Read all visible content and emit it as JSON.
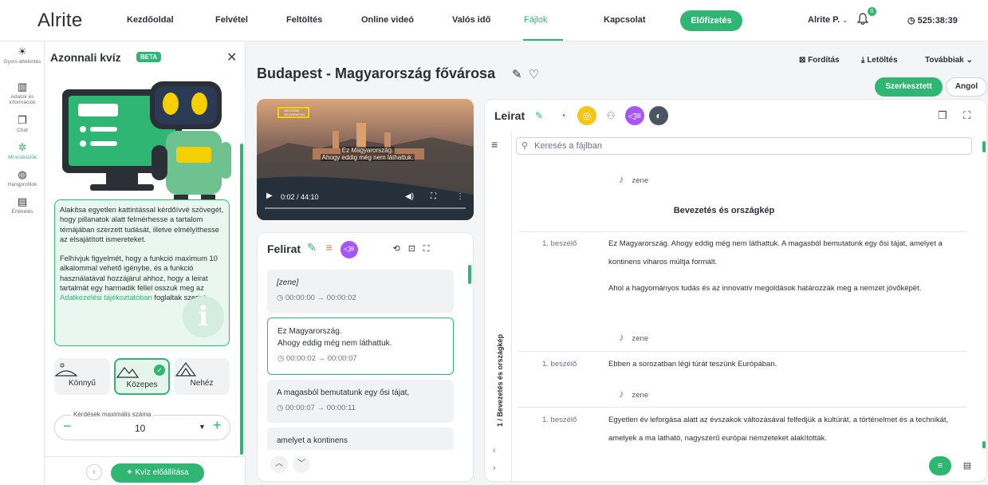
{
  "colors": {
    "accent": "#2fb673",
    "purple": "#a855f7",
    "text": "#2b2f36"
  },
  "nav": {
    "logo": "Alrite",
    "items": [
      "Kezdőoldal",
      "Felvétel",
      "Feltöltés",
      "Online videó",
      "Valós idő",
      "Fájlok",
      "Kapcsolat"
    ],
    "active": "Fájlok",
    "subscribe": "Előfizetés",
    "user": "Alrite P.",
    "notifications": "0",
    "timer": "525:38:39"
  },
  "rail": [
    {
      "icon": "lightbulb-icon",
      "label": "Gyors áttekintés"
    },
    {
      "icon": "chart-icon",
      "label": "Adatok és információk"
    },
    {
      "icon": "chat-icon",
      "label": "Chat"
    },
    {
      "icon": "ai-tools-icon",
      "label": "MI eszközök"
    },
    {
      "icon": "voice-profile-icon",
      "label": "Hangprofilok"
    },
    {
      "icon": "rating-icon",
      "label": "Értékelés"
    }
  ],
  "quiz": {
    "title": "Azonnali kvíz",
    "badge": "BETA",
    "info_p1": "Alakítsa egyetlen kattintással kérdőívvé szövegét, hogy pillanatok alatt felmérhesse a tartalom témájában szerzett tudását, illetve elmélyíthesse az elsajátított ismereteket.",
    "info_p2_before": "Felhívjuk figyelmét, hogy a funkció maximum 10 alkalommal vehető igénybe, és a funkció használatával hozzájárul ahhoz, hogy a leirat tartalmát egy harmadik féllel osszuk meg az ",
    "info_p2_link": "Adatkezelési tájékoztatóban",
    "info_p2_after": " foglaltak szerint.",
    "difficulties": [
      {
        "label": "Könnyű"
      },
      {
        "label": "Közepes"
      },
      {
        "label": "Nehéz"
      }
    ],
    "selected_difficulty": "Közepes",
    "max_questions_label": "Kérdések maximális száma",
    "max_questions_value": "10",
    "generate": "Kvíz előállítása"
  },
  "file": {
    "title": "Budapest - Magyarország fővárosa",
    "translate": "Fordítás",
    "download": "Letöltés",
    "more": "Továbbiak",
    "edited": "Szerkesztett",
    "language": "Angol"
  },
  "video": {
    "caption_line1": "Ez Magyarország.",
    "caption_line2": "Ahogy eddig még nem láthattuk.",
    "time": "0:02 / 44:10",
    "progress": 0.001,
    "brand": "NATIONAL GEOGRAPHIC"
  },
  "subtitles": {
    "title": "Felirat",
    "cues": [
      {
        "text": "[zene]",
        "time": "00:00:00 → 00:00:02"
      },
      {
        "text": "Ez Magyarország.\nAhogy eddig még nem láthattuk.",
        "time": "00:00:02 → 00:00:07"
      },
      {
        "text": "A magasból bemutatunk egy ősi tájat,",
        "time": "00:00:07 → 00:00:11"
      },
      {
        "text": "amelyet a kontinens",
        "time": ""
      }
    ]
  },
  "transcript": {
    "title": "Leirat",
    "search_placeholder": "Keresés a fájlban",
    "chapter_vertical": "1 / Bevezetés és országkép",
    "chapter": "Bevezetés és országkép",
    "music": "zene",
    "speaker": "1. beszélő",
    "p1a": "Ez Magyarország. Ahogy eddig még nem láthattuk. A magasból bemutatunk egy ősi tájat, amelyet a kontinens viharos múltja formált.",
    "p1b": "Ahol a hagyományos tudás és az innovatív megoldások határozzák meg a nemzet jövőképét.",
    "p2": "Ebben a sorozatban légi túrát teszünk Európában.",
    "p3": "Egyetlen év leforgása alatt az évszakok változásával felfedjük a kultúrát, a történelmet és a technikát, amelyek a ma látható, nagyszerű európai nemzeteket alakították."
  }
}
